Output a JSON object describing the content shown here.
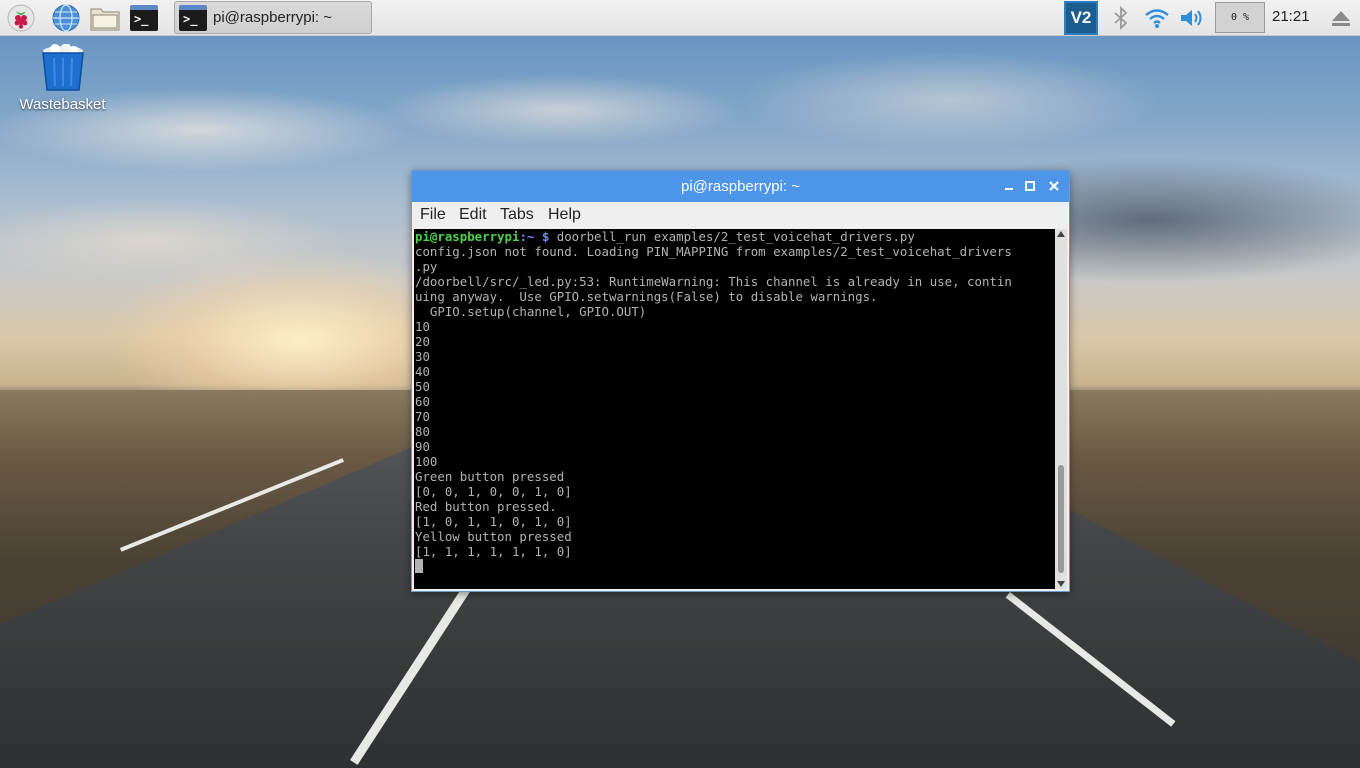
{
  "panel": {
    "task_title": "pi@raspberrypi: ~",
    "cpu_usage": "0 %",
    "clock": "21:21",
    "vnc_label": "V2",
    "icons": [
      "raspberry-menu-icon",
      "web-browser-icon",
      "file-manager-icon",
      "terminal-icon",
      "bluetooth-icon",
      "wifi-icon",
      "volume-icon",
      "eject-icon"
    ]
  },
  "desktop": {
    "wastebasket_label": "Wastebasket"
  },
  "window": {
    "title": "pi@raspberrypi: ~",
    "menu": [
      "File",
      "Edit",
      "Tabs",
      "Help"
    ],
    "terminal": {
      "prompt_user": "pi@raspberrypi",
      "prompt_sep": ":",
      "prompt_path": "~",
      "prompt_dollar": " $",
      "command": " doorbell_run examples/2_test_voicehat_drivers.py",
      "output": "config.json not found. Loading PIN_MAPPING from examples/2_test_voicehat_drivers\n.py\n/doorbell/src/_led.py:53: RuntimeWarning: This channel is already in use, contin\nuing anyway.  Use GPIO.setwarnings(False) to disable warnings.\n  GPIO.setup(channel, GPIO.OUT)\n10\n20\n30\n40\n50\n60\n70\n80\n90\n100\nGreen button pressed\n[0, 0, 1, 0, 0, 1, 0]\nRed button pressed.\n[1, 0, 1, 1, 0, 1, 0]\nYellow button pressed\n[1, 1, 1, 1, 1, 1, 0]"
    }
  },
  "colors": {
    "titlebar": "#4d95e6",
    "prompt_user": "#4fd14f",
    "prompt_path": "#6c88ff",
    "terminal_bg": "#000000",
    "terminal_fg": "#b2b2b2"
  }
}
